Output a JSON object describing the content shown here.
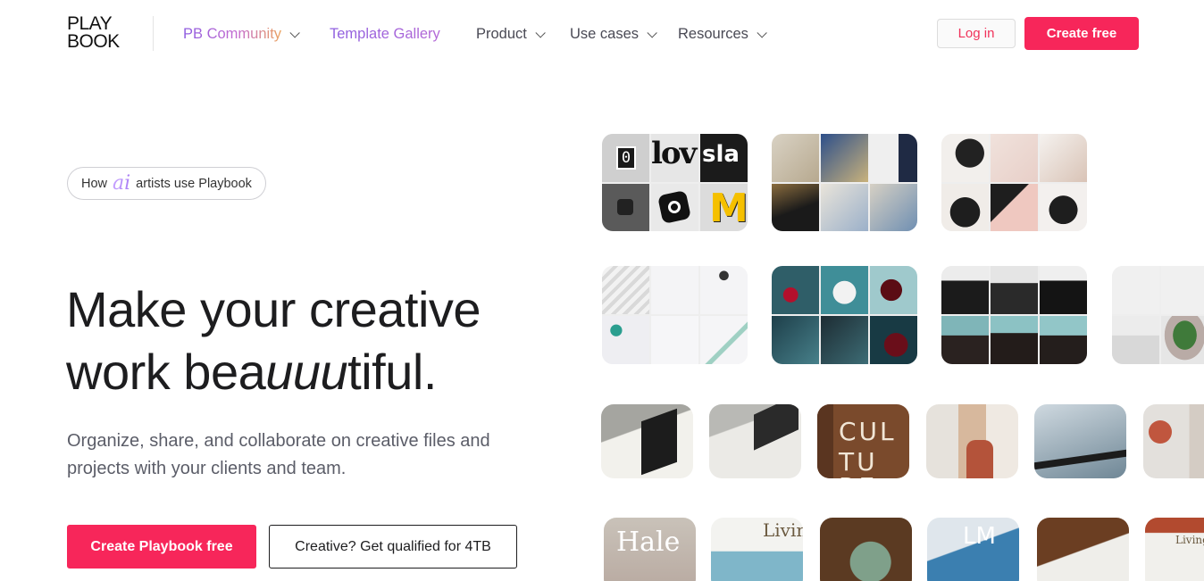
{
  "nav": {
    "logo_line1": "PLAY",
    "logo_line2": "BOOK",
    "items": [
      {
        "label": "PB Community",
        "dropdown": true
      },
      {
        "label": "Template Gallery",
        "dropdown": false
      },
      {
        "label": "Product",
        "dropdown": true
      },
      {
        "label": "Use cases",
        "dropdown": true
      },
      {
        "label": "Resources",
        "dropdown": true
      }
    ],
    "login_label": "Log in",
    "create_label": "Create free"
  },
  "hero": {
    "pill_prefix": "How",
    "pill_ai": "ai",
    "pill_suffix": "artists use Playbook",
    "headline_line1": "Make your creative",
    "headline_line2_a": "work bea",
    "headline_line2_italic": "uuu",
    "headline_line2_b": "tiful.",
    "subtext": "Organize, share, and collaborate on creative files and projects with your clients and team.",
    "primary_cta": "Create Playbook free",
    "secondary_cta": "Creative? Get qualified for 4TB"
  },
  "gallery": {
    "logo_tile": {
      "zero": "0",
      "lov": "lov",
      "slack": "sla",
      "m": "M"
    },
    "book_titles": [
      "CUL",
      "TU",
      "RE",
      "Hale",
      "Living",
      "LM",
      "Living"
    ],
    "colors": {
      "accent": "#f7265a",
      "nav_gradient_start": "#8d5ce0",
      "nav_gradient_end": "#eba35c",
      "text_dark": "#1d1d1f",
      "text_muted": "#5b5d68"
    }
  }
}
